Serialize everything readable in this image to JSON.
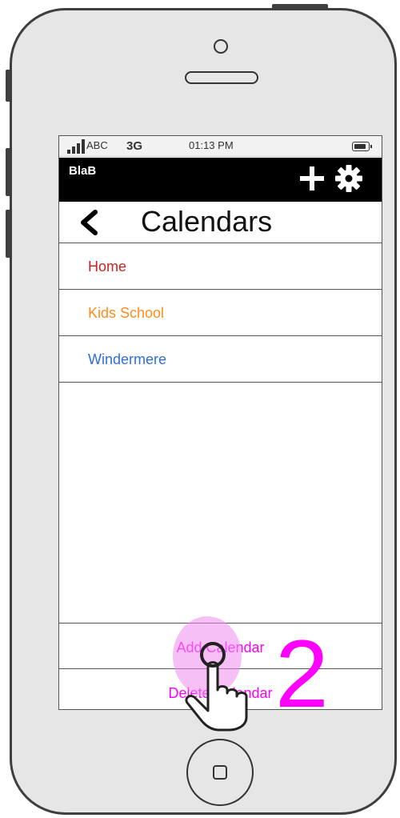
{
  "status_bar": {
    "carrier": "ABC",
    "network": "3G",
    "time": "01:13 PM"
  },
  "header": {
    "app_name": "BlaB",
    "add_icon": "plus-icon",
    "settings_icon": "gear-icon"
  },
  "title_bar": {
    "back_icon": "chevron-left-icon",
    "title": "Calendars"
  },
  "calendars": [
    {
      "name": "Home",
      "color": "#cc2222"
    },
    {
      "name": "Kids School",
      "color": "#ff8c1a"
    },
    {
      "name": "Windermere",
      "color": "#2f6fd8"
    }
  ],
  "actions": {
    "add_label": "Add Calendar",
    "delete_label": "Delete Calendar",
    "accent_color": "#ff00ff"
  },
  "annotation": {
    "step": "2",
    "gesture_icon": "tap-hand-icon"
  }
}
